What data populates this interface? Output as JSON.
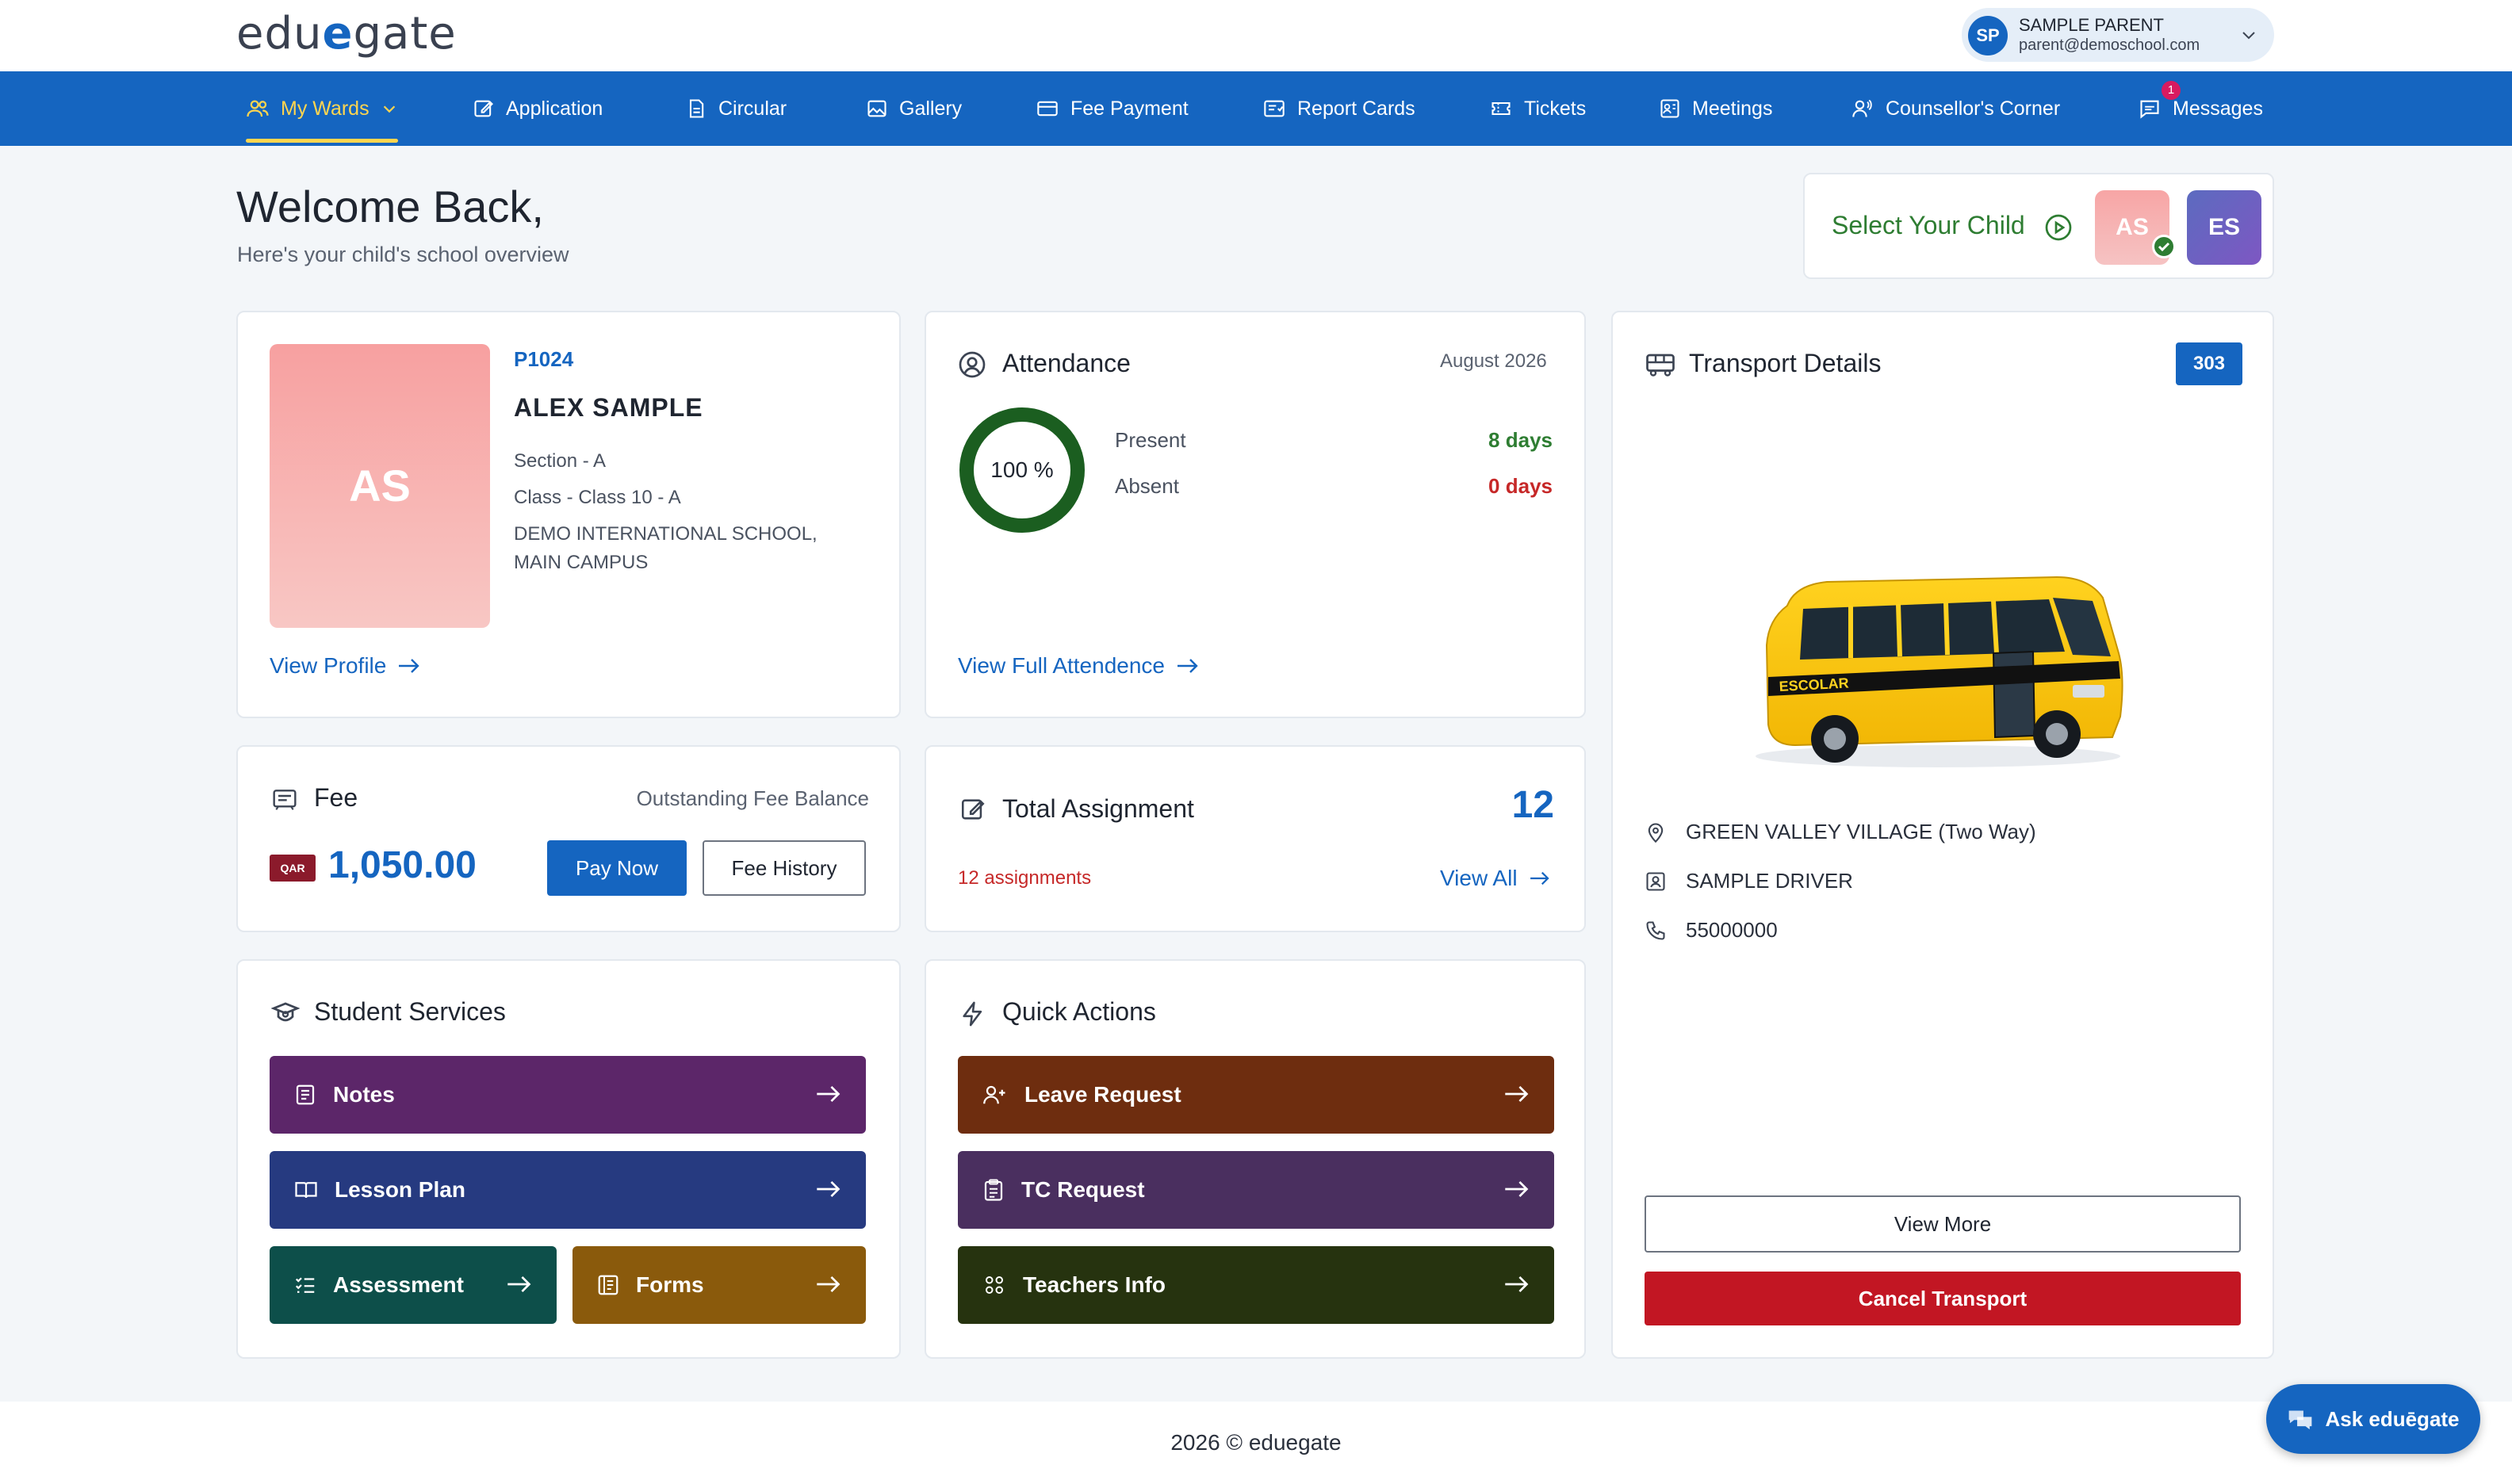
{
  "header": {
    "logo_text": "eduegate",
    "user": {
      "initials": "SP",
      "name": "SAMPLE PARENT",
      "email": "parent@demoschool.com"
    }
  },
  "nav": {
    "items": [
      {
        "label": "My Wards",
        "icon": "users-icon",
        "active": true
      },
      {
        "label": "Application",
        "icon": "edit-icon"
      },
      {
        "label": "Circular",
        "icon": "document-icon"
      },
      {
        "label": "Gallery",
        "icon": "image-icon"
      },
      {
        "label": "Fee Payment",
        "icon": "credit-card-icon"
      },
      {
        "label": "Report Cards",
        "icon": "report-icon"
      },
      {
        "label": "Tickets",
        "icon": "ticket-icon"
      },
      {
        "label": "Meetings",
        "icon": "meeting-icon"
      },
      {
        "label": "Counsellor's Corner",
        "icon": "counsellor-icon"
      },
      {
        "label": "Messages",
        "icon": "message-icon",
        "badge": "1"
      }
    ]
  },
  "welcome": {
    "title": "Welcome Back,",
    "subtitle": "Here's your child's school overview"
  },
  "child_selector": {
    "label": "Select Your Child",
    "children": [
      {
        "initials": "AS",
        "selected": true
      },
      {
        "initials": "ES",
        "selected": false
      }
    ]
  },
  "profile": {
    "initials": "AS",
    "id": "P1024",
    "name": "ALEX  SAMPLE",
    "section": "Section - A",
    "class": "Class - Class 10 - A",
    "school_line1": "DEMO INTERNATIONAL SCHOOL,",
    "school_line2": "MAIN CAMPUS",
    "link": "View Profile"
  },
  "attendance": {
    "title": "Attendance",
    "month": "August 2026",
    "percent_label": "100 %",
    "percent": 100,
    "present_label": "Present",
    "present_value": "8 days",
    "absent_label": "Absent",
    "absent_value": "0 days",
    "link": "View Full Attendence",
    "colors": {
      "present": "#2e7d32",
      "absent": "#c62828"
    }
  },
  "fee": {
    "title": "Fee",
    "balance_label": "Outstanding Fee Balance",
    "currency": "QAR",
    "amount": "1,050.00",
    "pay_label": "Pay Now",
    "history_label": "Fee History"
  },
  "assignments": {
    "title": "Total Assignment",
    "count": "12",
    "sub": "12 assignments",
    "link": "View All"
  },
  "student_services": {
    "title": "Student Services",
    "items": [
      {
        "label": "Notes",
        "color": "#5c2669"
      },
      {
        "label": "Lesson Plan",
        "color": "#263a80"
      },
      {
        "label": "Assessment",
        "color": "#0d4f4a"
      },
      {
        "label": "Forms",
        "color": "#8a5a0c"
      }
    ]
  },
  "quick_actions": {
    "title": "Quick Actions",
    "items": [
      {
        "label": "Leave Request",
        "color": "#6e2d0f"
      },
      {
        "label": "TC Request",
        "color": "#4a2f5f"
      },
      {
        "label": "Teachers Info",
        "color": "#26330f"
      }
    ]
  },
  "transport": {
    "title": "Transport Details",
    "route": "303",
    "bus_label": "ESCOLAR",
    "location": "GREEN VALLEY VILLAGE (Two Way)",
    "driver": "SAMPLE DRIVER",
    "phone": "55000000",
    "view_more": "View More",
    "cancel": "Cancel Transport"
  },
  "footer": {
    "text": "2026 © eduegate"
  },
  "ask": {
    "label": "Ask eduēgate"
  },
  "colors": {
    "brand": "#1565c0",
    "accent": "#ffd54f",
    "danger": "#c21623"
  }
}
